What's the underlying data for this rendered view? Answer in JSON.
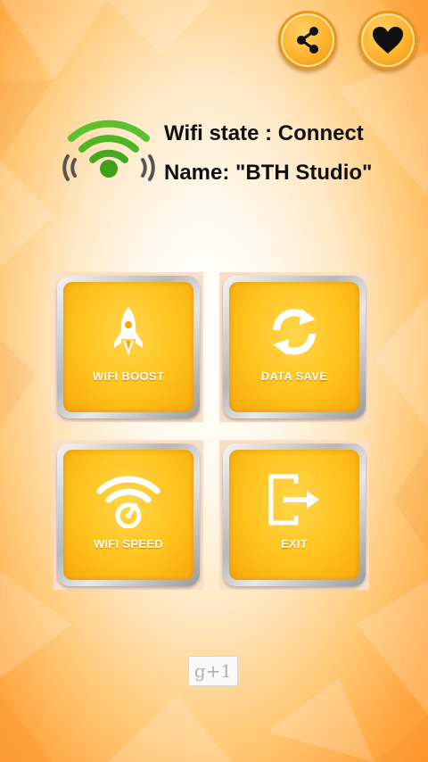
{
  "header": {
    "share_icon": "share-icon",
    "favorite_icon": "heart-icon"
  },
  "status": {
    "wifi_state": "Wifi state : Connect",
    "network_name": "Name: \"BTH Studio\""
  },
  "tiles": [
    {
      "label": "WIFI BOOST",
      "icon": "rocket-icon"
    },
    {
      "label": "DATA SAVE",
      "icon": "refresh-icon"
    },
    {
      "label": "WIFI SPEED",
      "icon": "speedometer-icon"
    },
    {
      "label": "EXIT",
      "icon": "exit-icon"
    }
  ],
  "footer": {
    "gplus_label": "g+1"
  },
  "colors": {
    "accent_orange": "#ffa640",
    "tile_yellow": "#ffc21c",
    "wifi_green": "#5cc030"
  }
}
